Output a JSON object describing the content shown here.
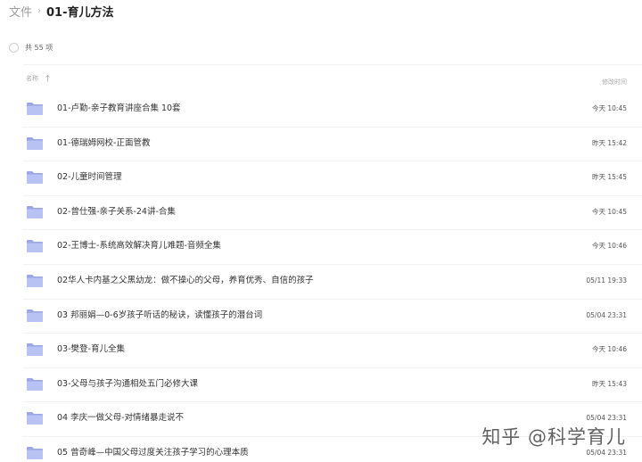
{
  "breadcrumb": {
    "root": "文件",
    "current": "01-育儿方法"
  },
  "summary": {
    "count_text": "共 55 项"
  },
  "columns": {
    "name": "名称",
    "modified": "修改时间"
  },
  "icons": {
    "folder": "folder-icon",
    "sort": "sort-ascending-icon",
    "select_all": "select-all-circle"
  },
  "colors": {
    "folder_back": "#9aa6e6",
    "folder_front": "#b8c2f3"
  },
  "rows": [
    {
      "name": "01-卢勤-亲子教育讲座合集 10套",
      "time": "今天 10:45"
    },
    {
      "name": "01-德瑞姆网校-正面管教",
      "time": "昨天 15:42"
    },
    {
      "name": "02-儿童时间管理",
      "time": "昨天 15:45"
    },
    {
      "name": "02-曾仕强-亲子关系-24讲-合集",
      "time": "今天 10:45"
    },
    {
      "name": "02-王博士-系统高效解决育儿难题-音频全集",
      "time": "今天 10:46"
    },
    {
      "name": "02华人卡内基之父黑幼龙：做不操心的父母，养育优秀、自信的孩子",
      "time": "05/11 19:33"
    },
    {
      "name": "03 邦丽娟—0-6岁孩子听话的秘诀，读懂孩子的潜台词",
      "time": "05/04 23:31"
    },
    {
      "name": "03-樊登-育儿全集",
      "time": "今天 10:46"
    },
    {
      "name": "03-父母与孩子沟通相处五门必修大课",
      "time": "昨天 15:43"
    },
    {
      "name": "04 李庆一做父母-对情绪暴走说不",
      "time": "05/04 23:31"
    },
    {
      "name": "05 曾奇峰—中国父母过度关注孩子学习的心理本质",
      "time": "05/04 23:31"
    }
  ],
  "watermark": "知乎 @科学育儿"
}
